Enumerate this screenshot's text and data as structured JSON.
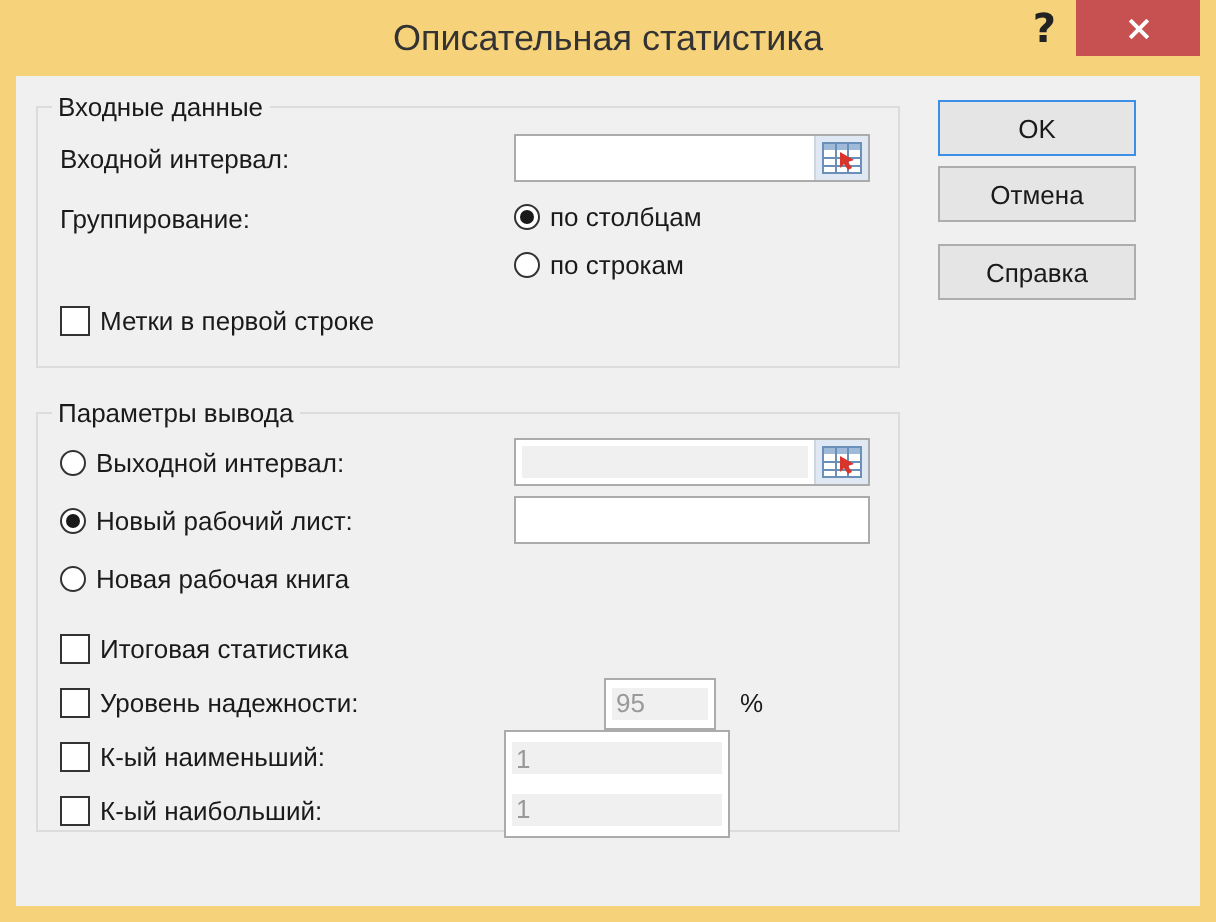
{
  "window": {
    "title": "Описательная статистика",
    "help": "?"
  },
  "input_group": {
    "title": "Входные данные",
    "range_label": "Входной интервал:",
    "grouping_label": "Группирование:",
    "grouping_options": [
      {
        "label": "по столбцам",
        "selected": true
      },
      {
        "label": "по строкам",
        "selected": false
      }
    ],
    "labels_checkbox": {
      "label": "Метки в первой строке",
      "checked": false
    }
  },
  "output_group": {
    "title": "Параметры вывода",
    "options": [
      {
        "kind": "range",
        "label": "Выходной интервал:",
        "selected": false,
        "disabled": true
      },
      {
        "kind": "sheet",
        "label": "Новый рабочий лист:",
        "selected": true,
        "disabled": false
      },
      {
        "kind": "book",
        "label": "Новая рабочая книга",
        "selected": false
      }
    ],
    "checks": [
      {
        "kind": "plain",
        "label": "Итоговая статистика",
        "checked": false
      },
      {
        "kind": "confidence",
        "label": "Уровень надежности:",
        "checked": false,
        "value": "95",
        "suffix": "%",
        "disabled": true
      },
      {
        "kind": "k",
        "label": "К-ый наименьший:",
        "checked": false,
        "value": "1",
        "disabled": true
      },
      {
        "kind": "k",
        "label": "К-ый наибольший:",
        "checked": false,
        "value": "1",
        "disabled": true
      }
    ]
  },
  "buttons": [
    {
      "label": "OK",
      "default": true
    },
    {
      "label": "Отмена",
      "default": false
    },
    {
      "label": "Справка",
      "default": false
    }
  ]
}
